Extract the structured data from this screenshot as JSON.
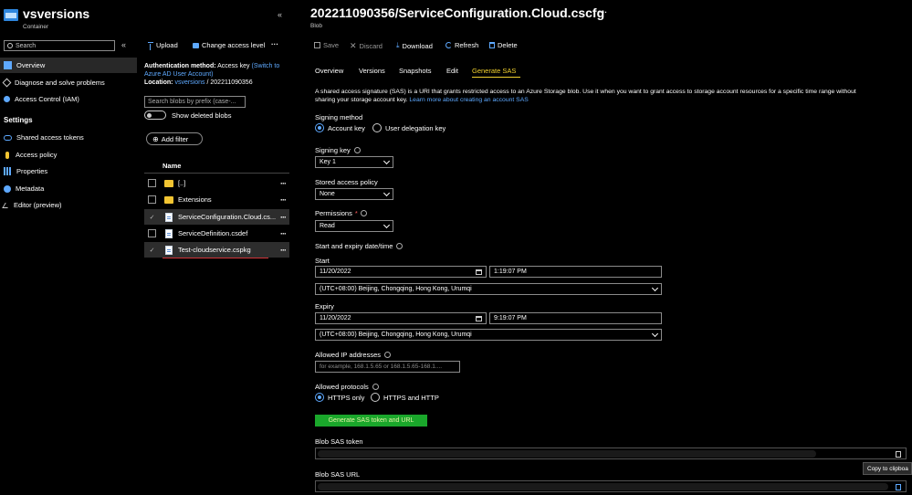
{
  "left": {
    "title": "vsversions",
    "subtitle": "Container",
    "search_placeholder": "Search",
    "collapse_glyph": "«",
    "nav": [
      {
        "label": "Overview",
        "icon": "overview-icon"
      },
      {
        "label": "Diagnose and solve problems",
        "icon": "diagnose-icon"
      },
      {
        "label": "Access Control (IAM)",
        "icon": "people-icon"
      }
    ],
    "settings_header": "Settings",
    "settings": [
      {
        "label": "Shared access tokens",
        "icon": "link-icon"
      },
      {
        "label": "Access policy",
        "icon": "key-icon"
      },
      {
        "label": "Properties",
        "icon": "properties-icon"
      },
      {
        "label": "Metadata",
        "icon": "info-icon"
      },
      {
        "label": "Editor (preview)",
        "icon": "pencil-icon"
      }
    ]
  },
  "mid": {
    "collapse_glyph": "«",
    "upload": "Upload",
    "change_access": "Change access level",
    "more": "···",
    "auth_label": "Authentication method:",
    "auth_value": "Access key",
    "auth_link_1": "(Switch to",
    "auth_link_2": "Azure AD User Account)",
    "location_label": "Location:",
    "location_link": "vsversions",
    "location_sep": "/",
    "location_value": "202211090356",
    "search_placeholder": "Search blobs by prefix (case-...",
    "show_deleted": "Show deleted blobs",
    "add_filter": "Add filter",
    "name_header": "Name",
    "files": [
      {
        "name": "[..]",
        "type": "folder",
        "checked": false
      },
      {
        "name": "Extensions",
        "type": "folder",
        "checked": false
      },
      {
        "name": "ServiceConfiguration.Cloud.cs...",
        "type": "file",
        "checked": true
      },
      {
        "name": "ServiceDefinition.csdef",
        "type": "file",
        "checked": false
      },
      {
        "name": "Test-cloudservice.cspkg",
        "type": "file",
        "checked": true
      }
    ]
  },
  "right": {
    "title": "202211090356/ServiceConfiguration.Cloud.cscfg",
    "title_more": "···",
    "subtitle": "Blob",
    "toolbar": {
      "save": "Save",
      "discard": "Discard",
      "download": "Download",
      "refresh": "Refresh",
      "delete": "Delete"
    },
    "tabs": [
      "Overview",
      "Versions",
      "Snapshots",
      "Edit",
      "Generate SAS"
    ],
    "active_tab": "Generate SAS",
    "description_1": "A shared access signature (SAS) is a URI that grants restricted access to an Azure Storage blob. Use it when you want to grant access to storage account resources for a specific time range without",
    "description_2": "sharing your storage account key.",
    "description_link": "Learn more about creating an account SAS",
    "signing_method_label": "Signing method",
    "signing_options": [
      "Account key",
      "User delegation key"
    ],
    "signing_key_label": "Signing key",
    "signing_key_value": "Key 1",
    "stored_policy_label": "Stored access policy",
    "stored_policy_value": "None",
    "permissions_label": "Permissions",
    "required_mark": "*",
    "permissions_value": "Read",
    "start_expiry_label": "Start and expiry date/time",
    "start_label": "Start",
    "start_date": "11/20/2022",
    "start_time": "1:19:07 PM",
    "start_tz": "(UTC+08:00) Beijing, Chongqing, Hong Kong, Urumqi",
    "expiry_label": "Expiry",
    "expiry_date": "11/20/2022",
    "expiry_time": "9:19:07 PM",
    "expiry_tz": "(UTC+08:00) Beijing, Chongqing, Hong Kong, Urumqi",
    "allowed_ip_label": "Allowed IP addresses",
    "allowed_ip_placeholder": "for example, 168.1.5.65 or 168.1.5.65-168.1....",
    "allowed_protocols_label": "Allowed protocols",
    "protocol_options": [
      "HTTPS only",
      "HTTPS and HTTP"
    ],
    "generate_button": "Generate SAS token and URL",
    "sas_token_label": "Blob SAS token",
    "sas_url_label": "Blob SAS URL",
    "copy_tooltip": "Copy to clipboa"
  }
}
